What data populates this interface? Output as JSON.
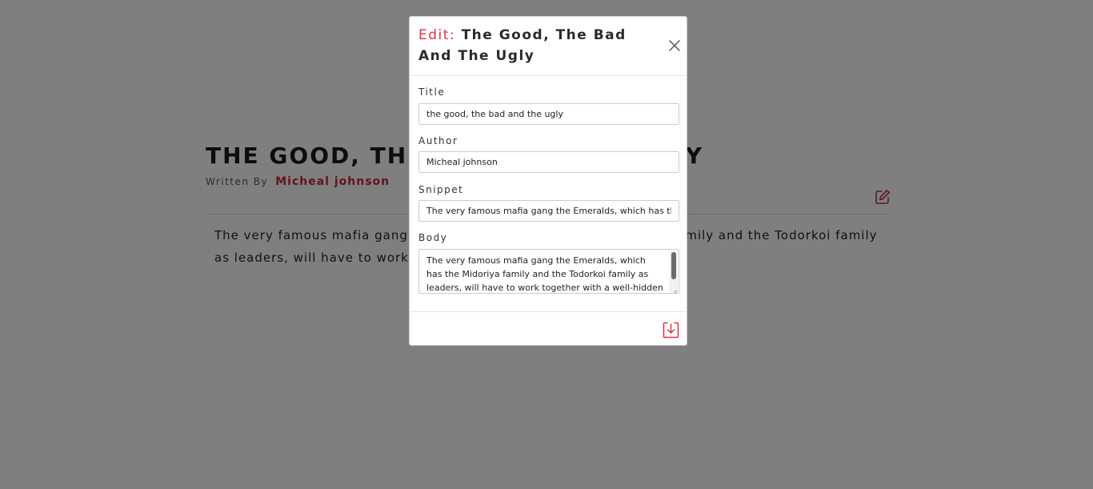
{
  "article": {
    "title": "THE GOOD, THE BAD AND THE UGLY",
    "written_by_label": "Written By",
    "author": "Micheal johnson",
    "body": "The very famous mafia gang the Emeralds, which has the Midoriya family and the Todorkoi family as leaders, will have to work together with a well-hidden group ..."
  },
  "icons": {
    "edit": "edit-icon",
    "close": "close-icon",
    "save": "save-download-icon"
  },
  "colors": {
    "accent": "#dc3545",
    "author": "#c5283d",
    "overlay": "rgba(0,0,0,0.5)"
  },
  "modal": {
    "edit_label": "Edit:",
    "title": "The Good, The Bad And The Ugly",
    "fields": {
      "title": {
        "label": "Title",
        "value": "the good, the bad and the ugly"
      },
      "author": {
        "label": "Author",
        "value": "Micheal johnson"
      },
      "snippet": {
        "label": "Snippet",
        "value": "The very famous mafia gang the Emeralds, which has the Midoriya family and the Todorkoi family as leaders"
      },
      "body": {
        "label": "Body",
        "value": "The very famous mafia gang the Emeralds, which has the Midoriya family and the Todorkoi family as leaders, will have to work together with a well-hidden group ..."
      }
    }
  }
}
